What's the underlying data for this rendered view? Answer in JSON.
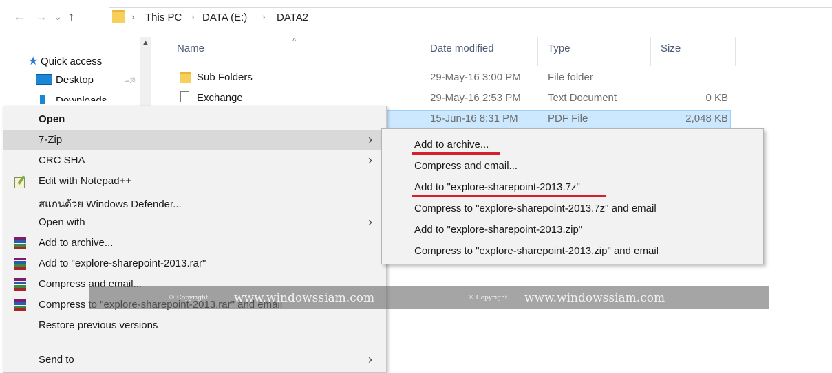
{
  "breadcrumb": {
    "items": [
      "This PC",
      "DATA (E:)",
      "DATA2"
    ],
    "separator": "›"
  },
  "nav_buttons": {
    "back": "←",
    "forward": "→",
    "recent": "⌄",
    "up": "↑"
  },
  "nav_pane": {
    "items": [
      {
        "label": "Quick access",
        "icon": "star-icon"
      },
      {
        "label": "Desktop",
        "icon": "desktop-icon",
        "pinned": true
      },
      {
        "label": "Downloads",
        "icon": "downloads-icon",
        "pinned": true
      }
    ]
  },
  "file_list": {
    "columns": [
      "Name",
      "Date modified",
      "Type",
      "Size"
    ],
    "rows": [
      {
        "name": "Sub Folders",
        "date": "29-May-16 3:00 PM",
        "type": "File folder",
        "size": "",
        "icon": "folder-icon"
      },
      {
        "name": "Exchange",
        "date": "29-May-16 2:53 PM",
        "type": "Text Document",
        "size": "0 KB",
        "icon": "text-file-icon"
      },
      {
        "name": "",
        "date": "15-Jun-16 8:31 PM",
        "type": "PDF File",
        "size": "2,048 KB",
        "icon": "pdf-icon",
        "selected": true
      }
    ]
  },
  "context_menu": {
    "items": [
      {
        "label": "Open",
        "bold": true
      },
      {
        "label": "7-Zip",
        "submenu": true,
        "highlighted": true
      },
      {
        "label": "CRC SHA",
        "submenu": true
      },
      {
        "label": "Edit with Notepad++",
        "icon": "notepad-icon"
      },
      {
        "label": "สแกนด้วย Windows Defender..."
      },
      {
        "label": "Open with",
        "submenu": true
      },
      {
        "label": "Add to archive...",
        "icon": "winrar-icon"
      },
      {
        "label": "Add to \"explore-sharepoint-2013.rar\"",
        "icon": "winrar-icon"
      },
      {
        "label": "Compress and email...",
        "icon": "winrar-icon"
      },
      {
        "label": "Compress to \"explore-sharepoint-2013.rar\" and email",
        "icon": "winrar-icon"
      },
      {
        "label": "Restore previous versions"
      },
      {
        "label": "Send to",
        "submenu": true
      }
    ],
    "arrow": "›"
  },
  "submenu_7zip": {
    "items": [
      {
        "label": "Add to archive...",
        "underlined": true
      },
      {
        "label": "Compress and email..."
      },
      {
        "label": "Add to \"explore-sharepoint-2013.7z\"",
        "underlined": true
      },
      {
        "label": "Compress to \"explore-sharepoint-2013.7z\" and email"
      },
      {
        "label": "Add to \"explore-sharepoint-2013.zip\""
      },
      {
        "label": "Compress to \"explore-sharepoint-2013.zip\" and email"
      }
    ]
  },
  "watermark": {
    "small": "© Copyright",
    "site": "www.windowssiam.com"
  },
  "colors": {
    "selection": "#cce8ff",
    "menu_bg": "#f2f2f2",
    "highlight": "#d9d9d9",
    "annotation_red": "#d6202a",
    "header_text": "#4d5b74"
  }
}
